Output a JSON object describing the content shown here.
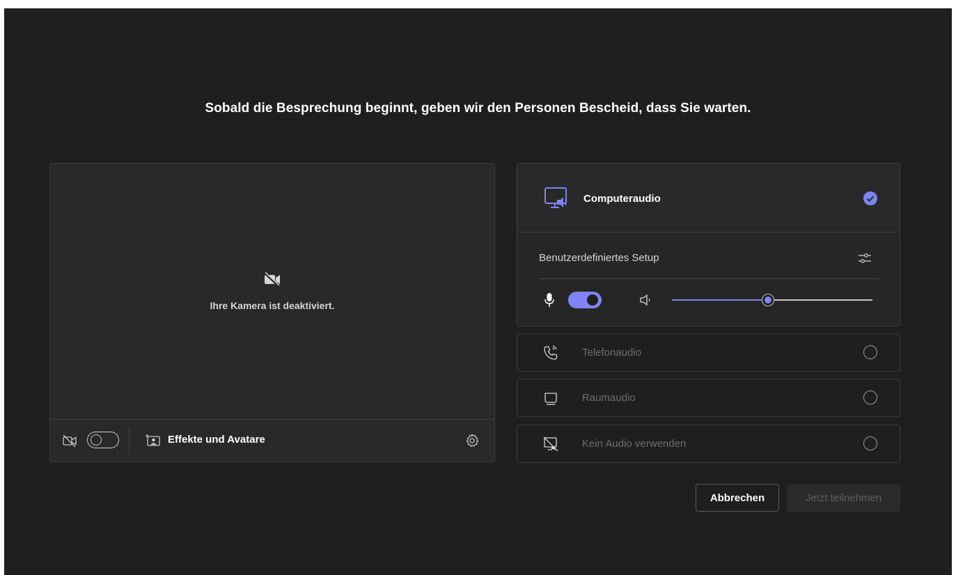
{
  "headline": "Sobald die Besprechung beginnt, geben wir den Personen Bescheid, dass Sie warten.",
  "video": {
    "camera_off_text": "Ihre Kamera ist deaktiviert.",
    "camera_toggle_on": false,
    "effects_label": "Effekte und Avatare"
  },
  "audio": {
    "computer": {
      "label": "Computeraudio",
      "selected": true
    },
    "setup_label": "Benutzerdefiniertes Setup",
    "mic_on": true,
    "volume_fraction": 0.48,
    "options": [
      {
        "label": "Telefonaudio",
        "icon": "phone-icon"
      },
      {
        "label": "Raumaudio",
        "icon": "room-display-icon"
      },
      {
        "label": "Kein Audio verwenden",
        "icon": "no-audio-icon"
      }
    ]
  },
  "buttons": {
    "cancel": "Abbrechen",
    "join": "Jetzt teilnehmen"
  },
  "colors": {
    "accent": "#7f85f5",
    "background": "#1f1f1f"
  }
}
